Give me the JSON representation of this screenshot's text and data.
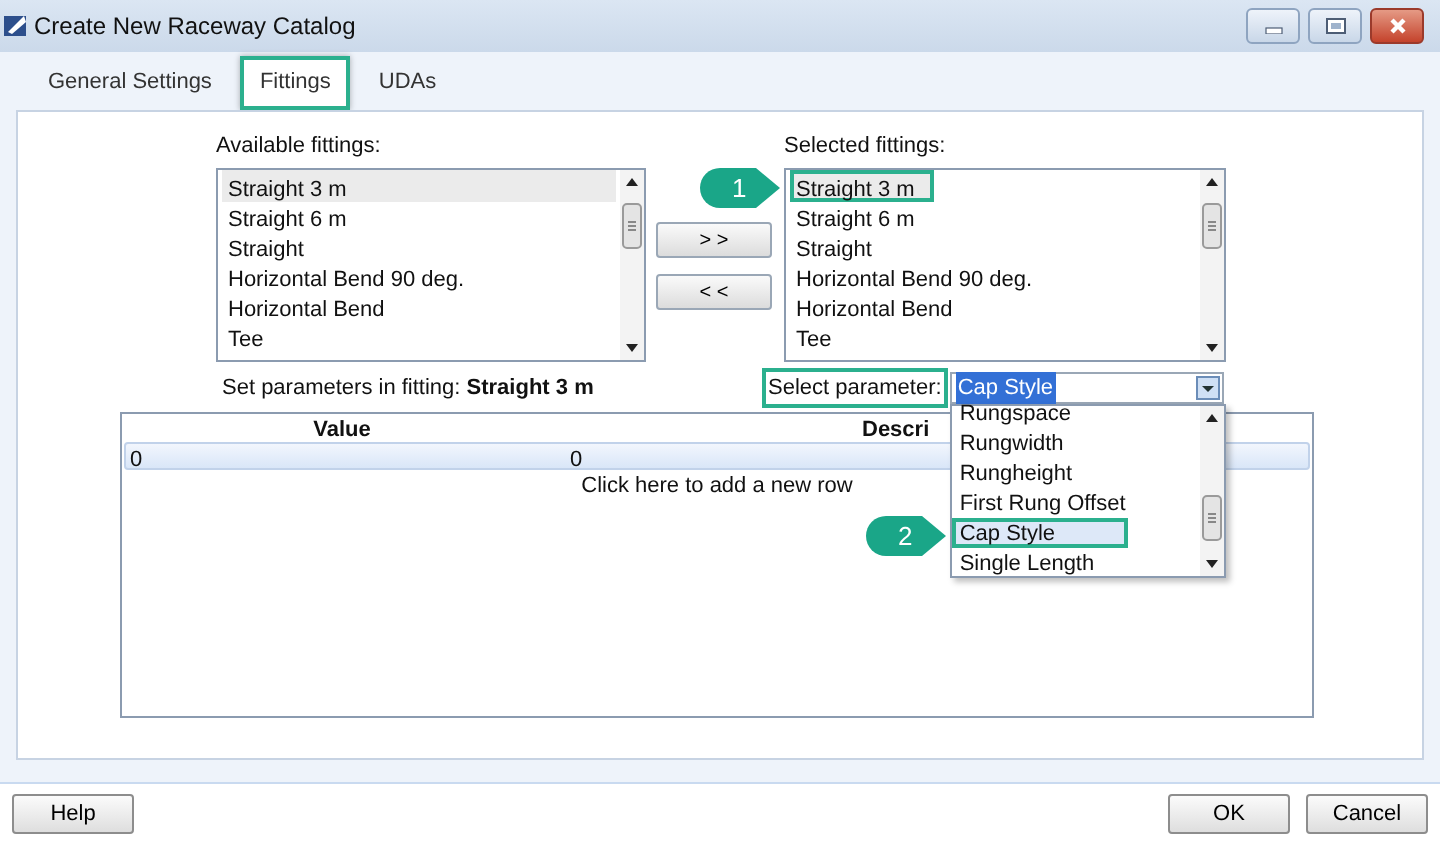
{
  "window": {
    "title": "Create New Raceway Catalog"
  },
  "tabs": [
    {
      "label": "General Settings",
      "selected": false,
      "highlighted": false
    },
    {
      "label": "Fittings",
      "selected": true,
      "highlighted": true
    },
    {
      "label": "UDAs",
      "selected": false,
      "highlighted": false
    }
  ],
  "available_fittings": {
    "label": "Available fittings:",
    "items": [
      {
        "label": "Straight 3 m",
        "selected": true,
        "highlighted": false
      },
      {
        "label": "Straight 6 m",
        "selected": false,
        "highlighted": false
      },
      {
        "label": "Straight",
        "selected": false,
        "highlighted": false
      },
      {
        "label": "Horizontal Bend 90 deg.",
        "selected": false,
        "highlighted": false
      },
      {
        "label": "Horizontal Bend",
        "selected": false,
        "highlighted": false
      },
      {
        "label": "Tee",
        "selected": false,
        "highlighted": false
      }
    ]
  },
  "move_buttons": [
    "> >",
    "< <"
  ],
  "selected_fittings": {
    "label": "Selected fittings:",
    "items": [
      {
        "label": "Straight 3 m",
        "selected": true,
        "highlighted": true,
        "callout": "1"
      },
      {
        "label": "Straight 6 m",
        "selected": false,
        "highlighted": false
      },
      {
        "label": "Straight",
        "selected": false,
        "highlighted": false
      },
      {
        "label": "Horizontal Bend 90 deg.",
        "selected": false,
        "highlighted": false
      },
      {
        "label": "Horizontal Bend",
        "selected": false,
        "highlighted": false
      },
      {
        "label": "Tee",
        "selected": false,
        "highlighted": false
      }
    ]
  },
  "fitting_caption": "Set parameters in fitting: **Straight 3 m**",
  "parameter": {
    "label": "Select parameter:",
    "highlighted": true,
    "value": "Cap Style",
    "options": [
      {
        "label": "Rungspace",
        "selected": false,
        "highlighted": false
      },
      {
        "label": "Rungwidth",
        "selected": false,
        "highlighted": false
      },
      {
        "label": "Rungheight",
        "selected": false,
        "highlighted": false
      },
      {
        "label": "First Rung Offset",
        "selected": false,
        "highlighted": false
      },
      {
        "label": "Cap Style",
        "selected": true,
        "highlighted": true,
        "callout": "2"
      },
      {
        "label": "Single Length",
        "selected": false,
        "highlighted": false
      }
    ]
  },
  "grid": {
    "columns": [
      "Value",
      "Descri"
    ],
    "rows": [
      [
        "0",
        "0"
      ]
    ],
    "add_row": "Click here to add a new row"
  },
  "help_button": "Help",
  "buttons": [
    "OK",
    "Cancel"
  ]
}
